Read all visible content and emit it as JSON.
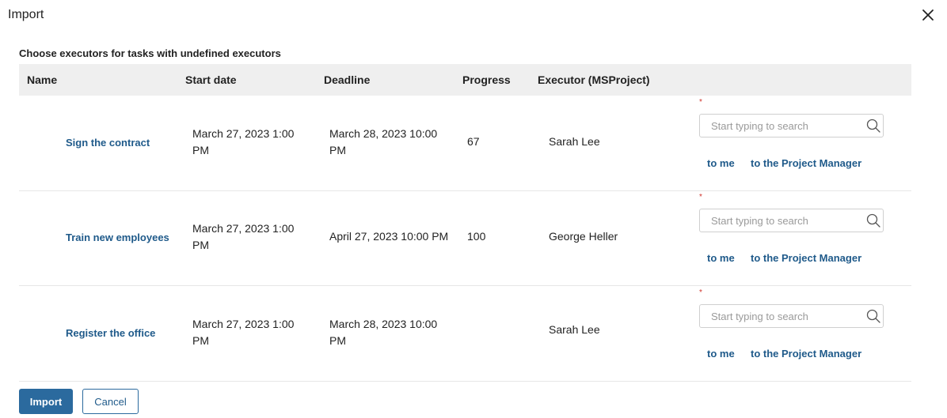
{
  "dialog": {
    "title": "Import",
    "subtitle": "Choose executors for tasks with undefined executors"
  },
  "columns": {
    "name": "Name",
    "start_date": "Start date",
    "deadline": "Deadline",
    "progress": "Progress",
    "executor": "Executor (MSProject)"
  },
  "rows": [
    {
      "name": "Sign the contract",
      "start_date": "March 27, 2023 1:00 PM",
      "deadline": "March 28, 2023 10:00 PM",
      "progress": "67",
      "executor": "Sarah Lee",
      "required_mark": "*",
      "search_placeholder": "Start typing to search",
      "to_me": "to me",
      "to_pm": "to the Project Manager"
    },
    {
      "name": "Train new employees",
      "start_date": "March 27, 2023 1:00 PM",
      "deadline": "April 27, 2023 10:00 PM",
      "progress": "100",
      "executor": "George Heller",
      "required_mark": "*",
      "search_placeholder": "Start typing to search",
      "to_me": "to me",
      "to_pm": "to the Project Manager"
    },
    {
      "name": "Register the office",
      "start_date": "March 27, 2023 1:00 PM",
      "deadline": "March 28, 2023 10:00 PM",
      "progress": "",
      "executor": "Sarah Lee",
      "required_mark": "*",
      "search_placeholder": "Start typing to search",
      "to_me": "to me",
      "to_pm": "to the Project Manager"
    }
  ],
  "footer": {
    "import_label": "Import",
    "cancel_label": "Cancel"
  },
  "icons": {
    "close": "close-icon",
    "search": "search-icon"
  },
  "colors": {
    "link": "#1f5a8a",
    "primary_button": "#2b6a9e",
    "required": "#d0342c",
    "header_bg": "#efefef"
  }
}
